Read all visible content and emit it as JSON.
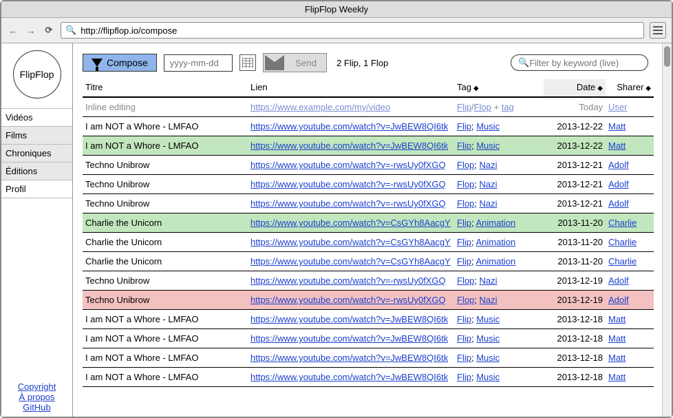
{
  "window": {
    "title": "FlipFlop Weekly"
  },
  "url": "http://flipflop.io/compose",
  "sidebar": {
    "logo": "FlipFlop",
    "items": [
      {
        "label": "Vidéos",
        "active": false
      },
      {
        "label": "Films",
        "active": true
      },
      {
        "label": "Chroniques",
        "active": true
      },
      {
        "label": "Éditions",
        "active": true
      },
      {
        "label": "Profil",
        "active": false
      }
    ],
    "footer": [
      {
        "label": "Copyright"
      },
      {
        "label": "À propos"
      },
      {
        "label": "GitHub"
      }
    ]
  },
  "toolbar": {
    "compose_label": "Compose",
    "date_placeholder": "yyyy-mm-dd",
    "send_label": "Send",
    "status": "2 Flip, 1 Flop",
    "filter_placeholder": "Filter by keyword (live)"
  },
  "table": {
    "headers": {
      "title": "Titre",
      "link": "Lien",
      "tag": "Tag",
      "date": "Date",
      "sharer": "Sharer"
    },
    "hint": {
      "title": "Inline editing",
      "link": "https://www.example.com/my/video",
      "tag_parts": {
        "a": "Flip",
        "b": "Flop",
        "plus": " + ",
        "c": "tag"
      },
      "date": "Today",
      "sharer": "User"
    },
    "rows": [
      {
        "title": "I am NOT a Whore - LMFAO",
        "link": "https://www.youtube.com/watch?v=JwBEW8QI6tk",
        "tags": [
          "Flip",
          "Music"
        ],
        "date": "2013-12-22",
        "sharer": "Matt",
        "cls": ""
      },
      {
        "title": "I am NOT a Whore - LMFAO",
        "link": "https://www.youtube.com/watch?v=JwBEW8QI6tk",
        "tags": [
          "Flip",
          "Music"
        ],
        "date": "2013-12-22",
        "sharer": "Matt",
        "cls": "green"
      },
      {
        "title": "Techno Unibrow",
        "link": "https://www.youtube.com/watch?v=-rwsUy0fXGQ",
        "tags": [
          "Flop",
          "Nazi"
        ],
        "date": "2013-12-21",
        "sharer": "Adolf",
        "cls": ""
      },
      {
        "title": "Techno Unibrow",
        "link": "https://www.youtube.com/watch?v=-rwsUy0fXGQ",
        "tags": [
          "Flop",
          "Nazi"
        ],
        "date": "2013-12-21",
        "sharer": "Adolf",
        "cls": ""
      },
      {
        "title": "Techno Unibrow",
        "link": "https://www.youtube.com/watch?v=-rwsUy0fXGQ",
        "tags": [
          "Flop",
          "Nazi"
        ],
        "date": "2013-12-21",
        "sharer": "Adolf",
        "cls": ""
      },
      {
        "title": "Charlie the Unicorn",
        "link": "https://www.youtube.com/watch?v=CsGYh8AacgY",
        "tags": [
          "Flip",
          "Animation"
        ],
        "date": "2013-11-20",
        "sharer": "Charlie",
        "cls": "green"
      },
      {
        "title": "Charlie the Unicorn",
        "link": "https://www.youtube.com/watch?v=CsGYh8AacgY",
        "tags": [
          "Flip",
          "Animation"
        ],
        "date": "2013-11-20",
        "sharer": "Charlie",
        "cls": ""
      },
      {
        "title": "Charlie the Unicorn",
        "link": "https://www.youtube.com/watch?v=CsGYh8AacgY",
        "tags": [
          "Flip",
          "Animation"
        ],
        "date": "2013-11-20",
        "sharer": "Charlie",
        "cls": ""
      },
      {
        "title": "Techno Unibrow",
        "link": "https://www.youtube.com/watch?v=-rwsUy0fXGQ",
        "tags": [
          "Flop",
          "Nazi"
        ],
        "date": "2013-12-19",
        "sharer": "Adolf",
        "cls": ""
      },
      {
        "title": "Techno Unibrow",
        "link": "https://www.youtube.com/watch?v=-rwsUy0fXGQ",
        "tags": [
          "Flop",
          "Nazi"
        ],
        "date": "2013-12-19",
        "sharer": "Adolf",
        "cls": "red"
      },
      {
        "title": "I am NOT a Whore - LMFAO",
        "link": "https://www.youtube.com/watch?v=JwBEW8QI6tk",
        "tags": [
          "Flip",
          "Music"
        ],
        "date": "2013-12-18",
        "sharer": "Matt",
        "cls": ""
      },
      {
        "title": "I am NOT a Whore - LMFAO",
        "link": "https://www.youtube.com/watch?v=JwBEW8QI6tk",
        "tags": [
          "Flip",
          "Music"
        ],
        "date": "2013-12-18",
        "sharer": "Matt",
        "cls": ""
      },
      {
        "title": "I am NOT a Whore - LMFAO",
        "link": "https://www.youtube.com/watch?v=JwBEW8QI6tk",
        "tags": [
          "Flip",
          "Music"
        ],
        "date": "2013-12-18",
        "sharer": "Matt",
        "cls": ""
      },
      {
        "title": "I am NOT a Whore - LMFAO",
        "link": "https://www.youtube.com/watch?v=JwBEW8QI6tk",
        "tags": [
          "Flip",
          "Music"
        ],
        "date": "2013-12-18",
        "sharer": "Matt",
        "cls": ""
      }
    ]
  }
}
